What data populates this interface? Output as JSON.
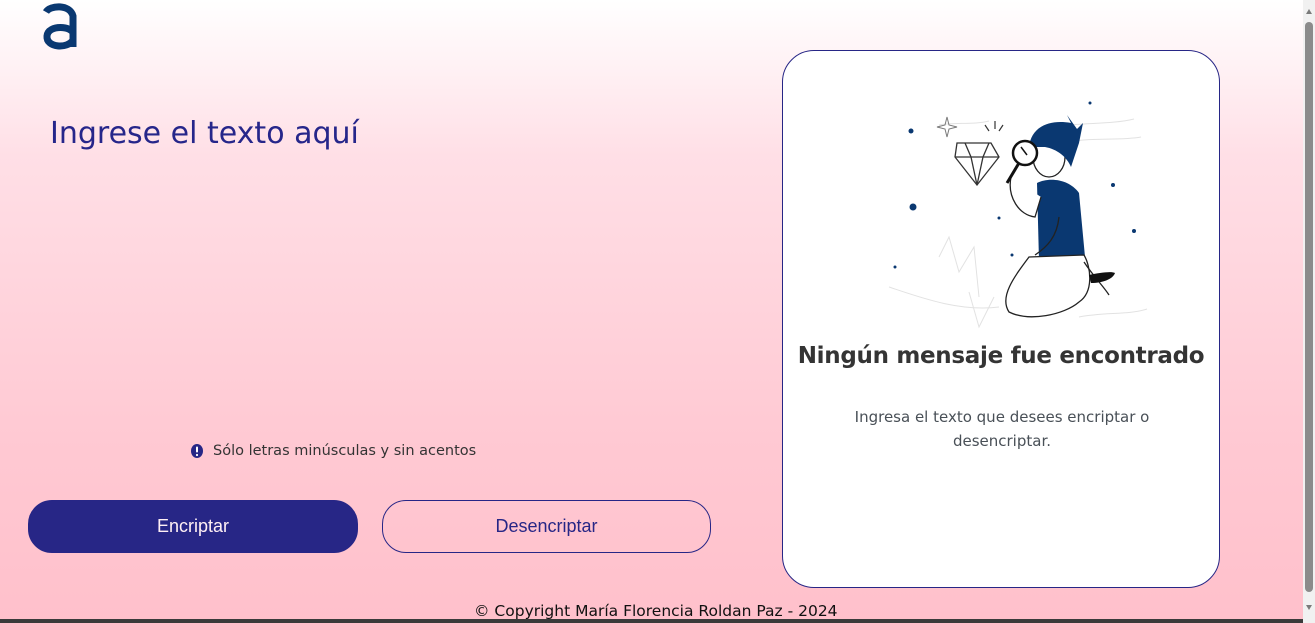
{
  "app": {
    "logo_icon": "alura-a-logo"
  },
  "input": {
    "placeholder": "Ingrese el texto aquí",
    "value": ""
  },
  "hint": {
    "icon": "exclamation-circle-icon",
    "text": "Sólo letras minúsculas y sin acentos"
  },
  "buttons": {
    "encrypt_label": "Encriptar",
    "decrypt_label": "Desencriptar"
  },
  "output_card": {
    "illustration": "person-with-magnifier-illustration",
    "title": "Ningún mensaje fue encontrado",
    "text": "Ingresa el texto que desees encriptar o desencriptar."
  },
  "footer": {
    "copyright": "© Copyright María Florencia Roldan Paz - 2024"
  },
  "colors": {
    "primary": "#272686",
    "background_top": "#ffffff",
    "background_bottom": "#ffc0cb",
    "logo": "#0a3871"
  }
}
